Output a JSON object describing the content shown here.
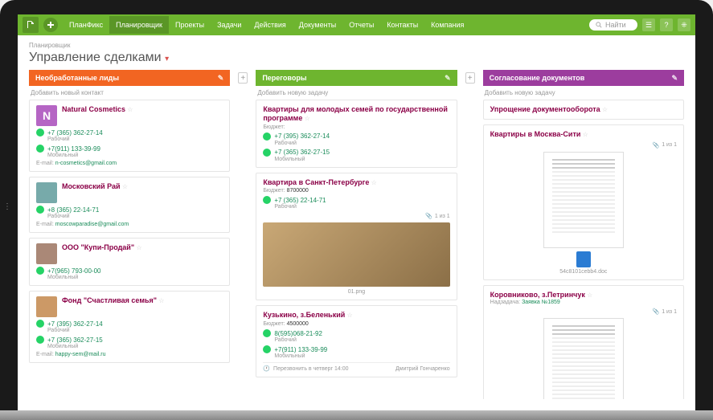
{
  "nav": {
    "items": [
      "ПланФикс",
      "Планировщик",
      "Проекты",
      "Задачи",
      "Действия",
      "Документы",
      "Отчеты",
      "Контакты",
      "Компания"
    ],
    "activeIndex": 1,
    "search_placeholder": "Найти"
  },
  "header": {
    "breadcrumb": "Планировщик",
    "title": "Управление сделками"
  },
  "columns": [
    {
      "title": "Необработанные лиды",
      "color": "orange",
      "add_text": "Добавить новый контакт",
      "cards": [
        {
          "type": "contact",
          "avatar": "N",
          "avatarClass": "av-n",
          "title": "Natural Cosmetics",
          "phones": [
            {
              "num": "+7 (365) 362-27-14",
              "kind": "Рабочий"
            },
            {
              "num": "+7(911) 133-39-99",
              "kind": "Мобильный"
            }
          ],
          "email": "n-cosmetics@gmail.com"
        },
        {
          "type": "contact",
          "avatar": "",
          "avatarClass": "av-img",
          "title": "Московский Рай",
          "phones": [
            {
              "num": "+8 (365) 22-14-71",
              "kind": "Рабочий"
            }
          ],
          "email": "moscowparadise@gmail.com"
        },
        {
          "type": "contact",
          "avatar": "",
          "avatarClass": "av-img2",
          "title": "ООО \"Купи-Продай\"",
          "phones": [
            {
              "num": "+7(965) 793-00-00",
              "kind": "Мобильный"
            }
          ]
        },
        {
          "type": "contact",
          "avatar": "",
          "avatarClass": "av-img3",
          "title": "Фонд \"Счастливая семья\"",
          "phones": [
            {
              "num": "+7 (395) 362-27-14",
              "kind": "Рабочий"
            },
            {
              "num": "+7 (365) 362-27-15",
              "kind": "Мобильный"
            }
          ],
          "email": "happy-sem@mail.ru"
        }
      ]
    },
    {
      "title": "Переговоры",
      "color": "green",
      "add_text": "Добавить новую задачу",
      "cards": [
        {
          "type": "task",
          "title": "Квартиры для молодых семей по государственной программе",
          "budget_label": "Бюджет:",
          "budget": "",
          "phones": [
            {
              "num": "+7 (395) 362-27-14",
              "kind": "Рабочий"
            },
            {
              "num": "+7 (365) 362-27-15",
              "kind": "Мобильный"
            }
          ]
        },
        {
          "type": "task",
          "title": "Квартира в Санкт-Петербурге",
          "budget_label": "Бюджет:",
          "budget": "8700000",
          "phones": [
            {
              "num": "+7 (365) 22-14-71",
              "kind": "Рабочий"
            }
          ],
          "attach": "1 из 1",
          "preview": "img",
          "file": "01.png"
        },
        {
          "type": "task",
          "title": "Кузькино, з.Беленький",
          "budget_label": "Бюджет:",
          "budget": "4500000",
          "phones": [
            {
              "num": "8(595)068-21-92",
              "kind": "Рабочий"
            },
            {
              "num": "+7(911) 133-39-99",
              "kind": "Мобильный"
            }
          ],
          "footer_text": "Перезвонить в четверг 14:00",
          "footer_user": "Дмитрий Гончаренко"
        }
      ]
    },
    {
      "title": "Согласование документов",
      "color": "purple",
      "add_text": "Добавить новую задачу",
      "cards": [
        {
          "type": "task",
          "title": "Упрощение документооборота"
        },
        {
          "type": "task",
          "title": "Квартиры в Москва-Сити",
          "attach": "1 из 1",
          "preview": "doc",
          "file": "54c8101cebb4.doc"
        },
        {
          "type": "task",
          "title": "Коровниково, з.Петринчук",
          "sub_label": "Надзадача:",
          "sub_link": "Заявка №1859",
          "attach": "1 из 1",
          "preview": "doc"
        }
      ]
    }
  ],
  "labels": {
    "email": "E-mail:"
  }
}
